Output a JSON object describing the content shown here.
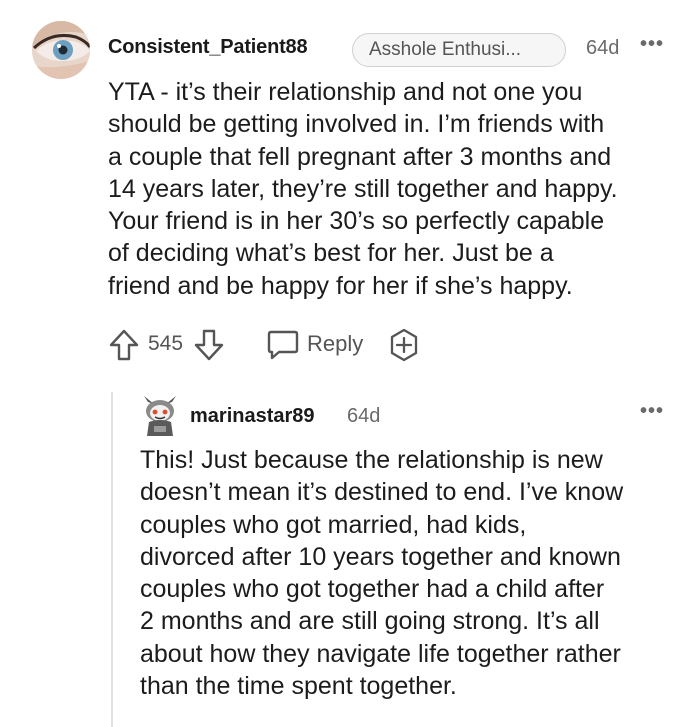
{
  "top_comment": {
    "username": "Consistent_Patient88",
    "flair": "Asshole Enthusi...",
    "age": "64d",
    "more": "•••",
    "body_lines": [
      "YTA - it’s their relationship and not one you",
      "should be getting involved in. I’m friends with",
      "a couple that fell pregnant after 3 months and",
      "14 years later, they’re still together and happy.",
      "Your friend is in her 30’s so perfectly capable",
      "of deciding what’s best for her. Just be a",
      "friend and be happy for her if she’s happy."
    ],
    "score": "545",
    "reply_label": "Reply"
  },
  "reply_comment": {
    "username": "marinastar89",
    "age": "64d",
    "more": "•••",
    "body_lines": [
      "This! Just because the relationship is new",
      "doesn’t mean it’s destined to end. I’ve know",
      "couples who got married, had kids,",
      "divorced after 10 years together and known",
      "couples who got together had a child after",
      "2 months and are still going strong. It’s all",
      "about how they navigate life together rather",
      "than the time spent together."
    ]
  },
  "icons": {
    "upvote": "upvote-arrow-icon",
    "downvote": "downvote-arrow-icon",
    "reply": "speech-bubble-icon",
    "award": "award-plus-icon",
    "more": "ellipsis-icon"
  },
  "colors": {
    "text": "#1c1c1c",
    "muted": "#6a6a6a",
    "flair_border": "#d0d0d0",
    "thread_line": "#e2e2e2"
  }
}
